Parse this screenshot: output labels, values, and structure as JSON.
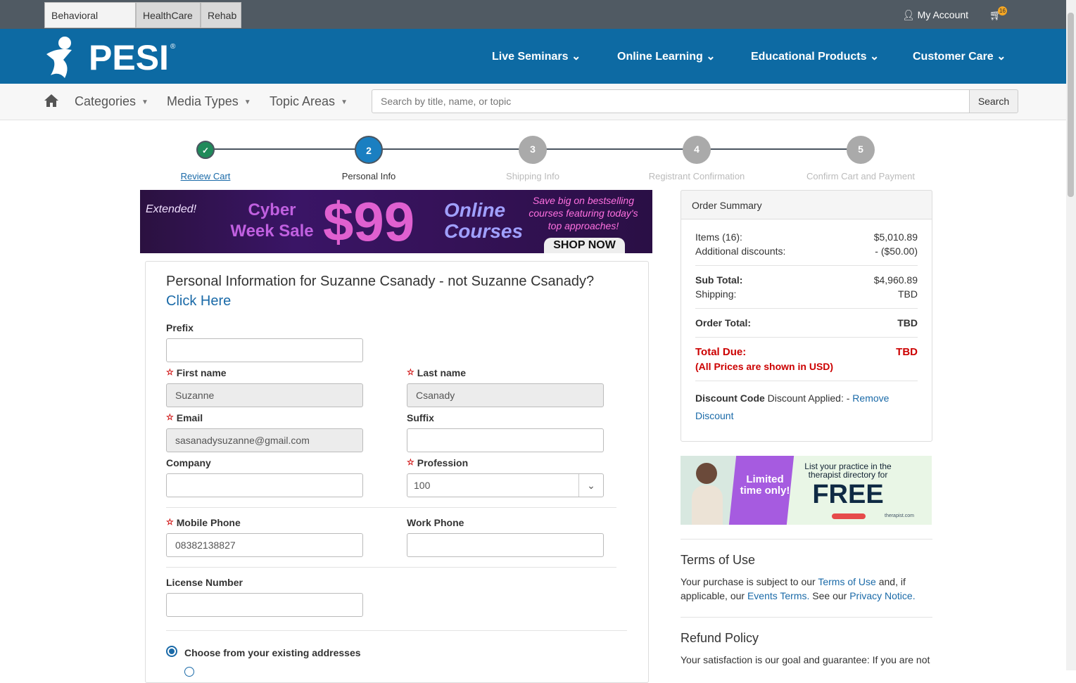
{
  "topbar": {
    "tabs": [
      "Behavioral Health",
      "HealthCare",
      "Rehab"
    ],
    "account": "My Account",
    "cart_count": "16"
  },
  "nav": {
    "logo": "PESI",
    "items": [
      "Live Seminars",
      "Online Learning",
      "Educational Products",
      "Customer Care"
    ]
  },
  "subnav": {
    "items": [
      "Categories",
      "Media Types",
      "Topic Areas"
    ],
    "search_placeholder": "Search by title, name, or topic",
    "search_button": "Search"
  },
  "steps": [
    {
      "num": "✓",
      "label": "Review Cart"
    },
    {
      "num": "2",
      "label": "Personal Info"
    },
    {
      "num": "3",
      "label": "Shipping Info"
    },
    {
      "num": "4",
      "label": "Registrant Confirmation"
    },
    {
      "num": "5",
      "label": "Confirm Cart and Payment"
    }
  ],
  "banner": {
    "extended": "Extended!",
    "sale": "Cyber Week Sale",
    "price": "$99",
    "online": "Online Courses",
    "save": "Save big on bestselling courses featuring today's top approaches!",
    "cta": "SHOP NOW"
  },
  "form": {
    "heading": "Personal Information for Suzanne Csanady - not Suzanne Csanady?",
    "click_here": "Click Here",
    "prefix_label": "Prefix",
    "first_label": "First name",
    "first_value": "Suzanne",
    "last_label": "Last name",
    "last_value": "Csanady",
    "email_label": "Email",
    "email_value": "sasanadysuzanne@gmail.com",
    "suffix_label": "Suffix",
    "company_label": "Company",
    "profession_label": "Profession",
    "profession_value": "100",
    "mobile_label": "Mobile Phone",
    "mobile_value": "08382138827",
    "work_label": "Work Phone",
    "license_label": "License Number",
    "address_option": "Choose from your existing addresses"
  },
  "summary": {
    "title": "Order Summary",
    "items_label": "Items (16):",
    "items_value": "$5,010.89",
    "disc_label": "Additional discounts:",
    "disc_value": "- ($50.00)",
    "sub_label": "Sub Total:",
    "sub_value": "$4,960.89",
    "ship_label": "Shipping:",
    "ship_value": "TBD",
    "order_label": "Order Total:",
    "order_value": "TBD",
    "due_label": "Total Due:",
    "due_value": "TBD",
    "usd_note": "(All Prices are shown in USD)",
    "dc_label": "Discount Code",
    "dc_text": "Discount Applied: -",
    "remove": "Remove",
    "discount": "Discount"
  },
  "ad": {
    "limited": "Limited time only!",
    "list": "List your practice in the therapist directory for",
    "free": "FREE",
    "brand": "therapist.com"
  },
  "terms": {
    "title": "Terms of Use",
    "t1": "Your purchase is subject to our",
    "l1": "Terms of Use",
    "t2": "and, if",
    "t3": "applicable, our",
    "l2": "Events Terms.",
    "t4": "See our",
    "l3": "Privacy Notice."
  },
  "refund": {
    "title": "Refund Policy",
    "text": "Your satisfaction is our goal and guarantee: If you are not"
  }
}
